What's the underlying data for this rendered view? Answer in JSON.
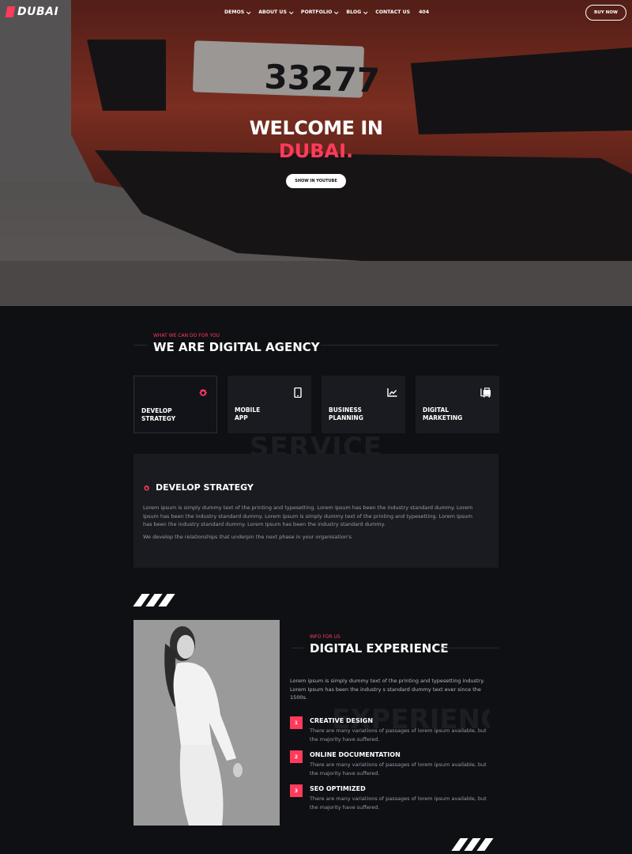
{
  "nav": {
    "logo": "DUBAI",
    "menu": [
      {
        "label": "DEMOS",
        "dropdown": true
      },
      {
        "label": "ABOUT US",
        "dropdown": true
      },
      {
        "label": "PORTFOLIO",
        "dropdown": true
      },
      {
        "label": "BLOG",
        "dropdown": true
      },
      {
        "label": "CONTACT US",
        "dropdown": false
      },
      {
        "label": "404",
        "dropdown": false
      }
    ],
    "buy_button": "BUY NOW"
  },
  "hero": {
    "title_line1": "WELCOME IN",
    "title_line2": "DUBAI.",
    "button": "SHOW IN YOUTUBE",
    "plate_text": "33277"
  },
  "services": {
    "subtitle": "WHAT WE CAN DO FOR YOU",
    "title": "WE ARE DIGITAL AGENCY",
    "cards": [
      {
        "label_line1": "DEVELOP",
        "label_line2": "STRATEGY",
        "icon": "gear-icon",
        "active": true
      },
      {
        "label_line1": "MOBILE",
        "label_line2": "APP",
        "icon": "mobile-icon",
        "active": false
      },
      {
        "label_line1": "BUSINESS",
        "label_line2": "PLANNING",
        "icon": "chart-icon",
        "active": false
      },
      {
        "label_line1": "DIGITAL",
        "label_line2": "MARKETING",
        "icon": "marketing-icon",
        "active": false
      }
    ],
    "watermark": "SERVICE",
    "panel": {
      "title": "DEVELOP STRATEGY",
      "text": "Lorem ipsum is simply dummy text of the printing and typesetting. Lorem Ipsum has been the industry standard dummy. Lorem Ipsum has been the industry standard dummy. Lorem ipsum is simply dummy text of the printing and typesetting. Lorem Ipsum has been the industry standard dummy. Lorem Ipsum has been the industry standard dummy.",
      "text2": "We develop the relationships that underpin the next phase in your organisation's"
    }
  },
  "experience": {
    "subtitle": "INFO FOR US",
    "title": "DIGITAL EXPERIENCE",
    "intro": "Lorem ipsum is simply dummy text of the printing and typesetting industry. Lorem Ipsum has been the industry s standard dummy text ever since the 1500s.",
    "watermark": "EXPERIENCE",
    "features": [
      {
        "num": "1",
        "title": "CREATIVE DESIGN",
        "text": "There are many variations of passages of lorem ipsum available, but the majority have suffered."
      },
      {
        "num": "2",
        "title": "ONLINE DOCUMENTATION",
        "text": "There are many variations of passages of lorem ipsum available, but the majority have suffered."
      },
      {
        "num": "3",
        "title": "SEO OPTIMIZED",
        "text": "There are many variations of passages of lorem ipsum available, but the majority have suffered."
      }
    ]
  },
  "colors": {
    "accent": "#ff3b5c",
    "background": "#0f1014",
    "card": "#1a1b20"
  }
}
